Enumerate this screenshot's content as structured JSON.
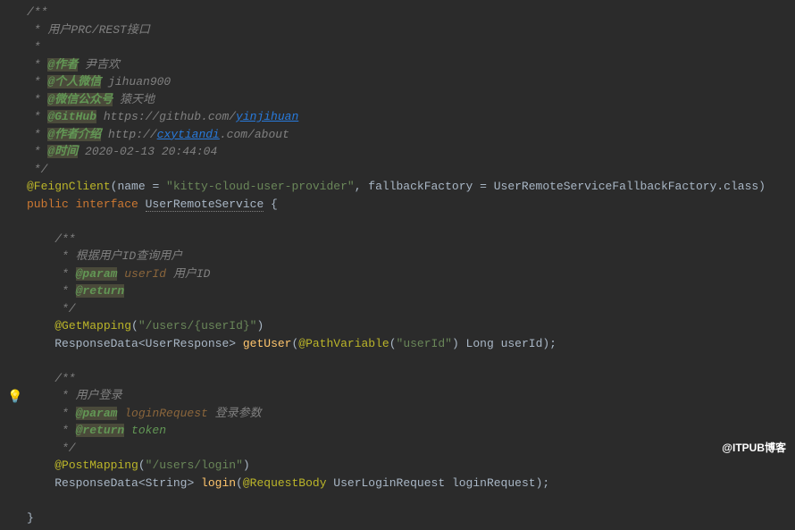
{
  "watermark": "@ITPUB博客",
  "doc": {
    "open": "/**",
    "l1": " * 用户PRC/REST接口",
    "blank": " *",
    "author_tag": "@作者",
    "author_val": " 尹吉欢",
    "wechat_tag": "@个人微信",
    "wechat_val": " jihuan900",
    "mp_tag": "@微信公众号",
    "mp_val": " 猿天地",
    "github_tag": "@GitHub",
    "github_pre": " https://github.com/",
    "github_link": "yinjihuan",
    "intro_tag": "@作者介绍",
    "intro_pre": " http://",
    "intro_link": "cxytiandi",
    "intro_post": ".com/about",
    "time_tag": "@时间",
    "time_val": " 2020-02-13 20:44:04",
    "close": " */"
  },
  "decl": {
    "annotation": "@FeignClient",
    "name_attr": "name = ",
    "name_val": "\"kitty-cloud-user-provider\"",
    "fallback_attr": ", fallbackFactory = ",
    "fallback_val": "UserRemoteServiceFallbackFactory",
    "class_kw": ".class",
    "public": "public ",
    "interface": "interface ",
    "iname": "UserRemoteService",
    "brace": " {"
  },
  "m1": {
    "doc_open": "    /**",
    "doc1": "     * 根据用户ID查询用户",
    "star": "     * ",
    "param_tag": "@param",
    "param_name": " userId",
    "param_desc": " 用户ID",
    "return_tag": "@return",
    "doc_close": "     */",
    "mapping": "@GetMapping",
    "path": "\"/users/{userId}\"",
    "ret_type": "ResponseData<UserResponse> ",
    "method": "getUser",
    "pv": "@PathVariable",
    "pv_val": "\"userId\"",
    "arg_type": " Long ",
    "arg_name": "userId"
  },
  "m2": {
    "doc_open": "    /**",
    "doc1": "     * 用户登录",
    "star": "     * ",
    "param_tag": "@param",
    "param_name": " loginRequest",
    "param_desc": " 登录参数",
    "return_tag": "@return",
    "return_desc": " token",
    "doc_close": "     */",
    "mapping": "@PostMapping",
    "path": "\"/users/login\"",
    "ret_type": "ResponseData<String> ",
    "method": "login",
    "rb": "@RequestBody",
    "arg_type": " UserLoginRequest ",
    "arg_name": "loginRequest"
  },
  "close_brace": "}"
}
